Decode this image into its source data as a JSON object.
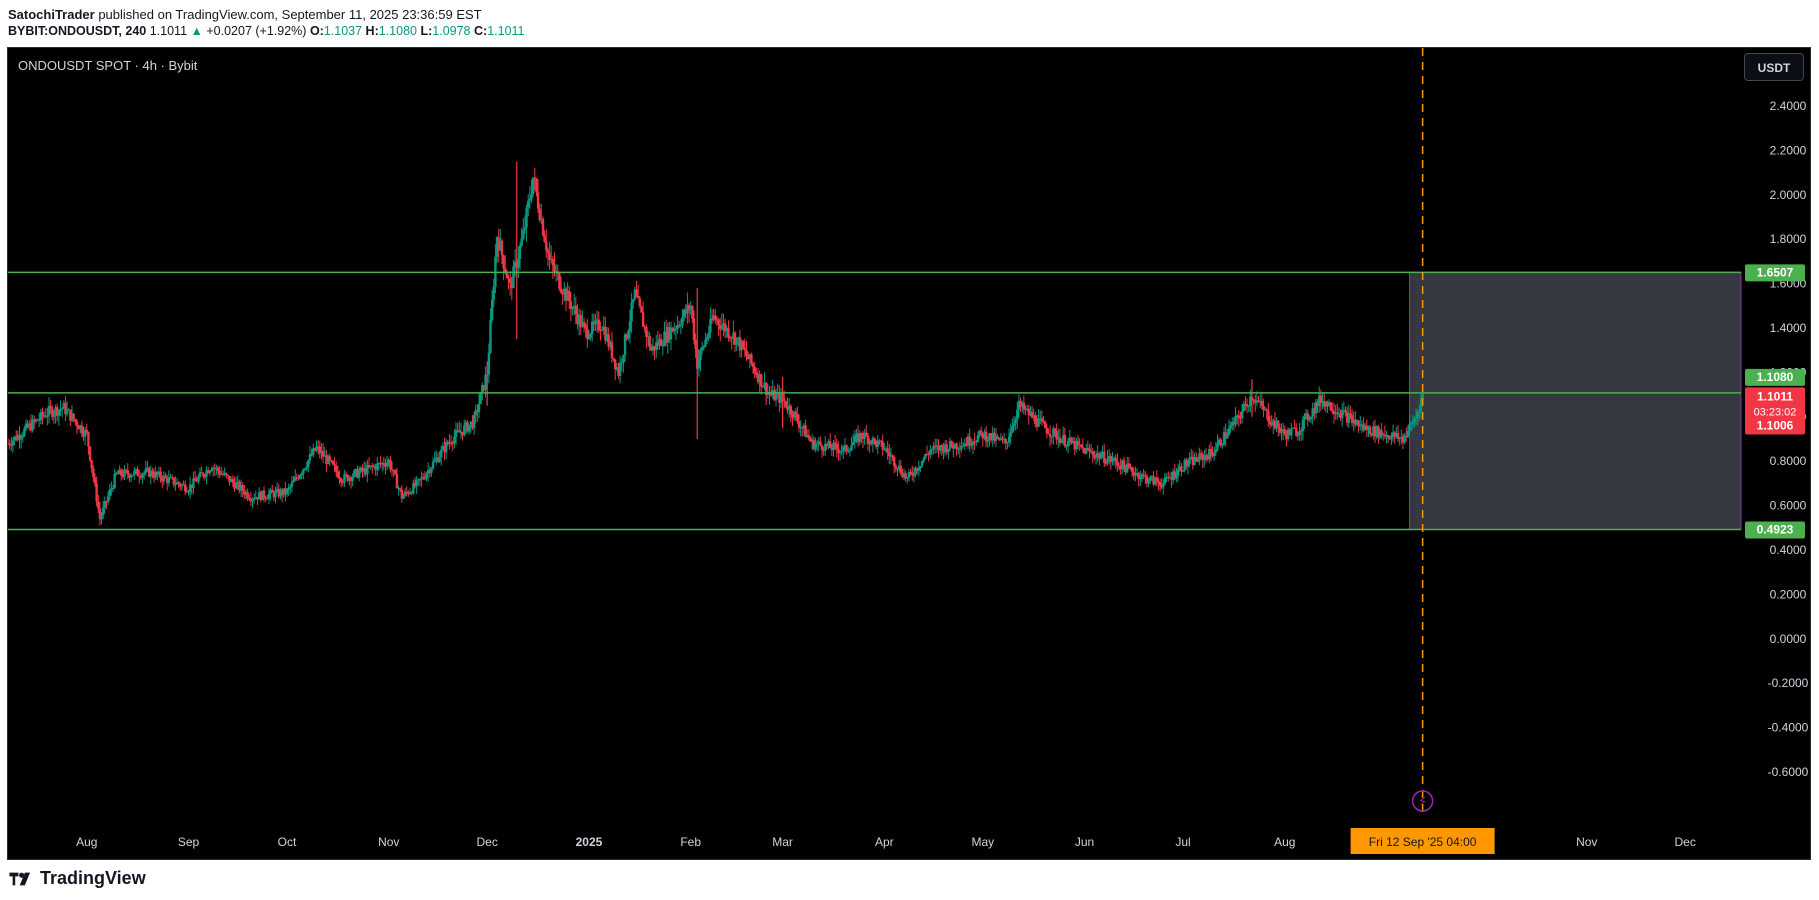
{
  "header": {
    "author": "SatochiTrader",
    "published_text": "published on TradingView.com, September 11, 2025 23:36:59 EST",
    "symbol_line": "BYBIT:ONDOUSDT, 240",
    "last": "1.1011",
    "change": "+0.0207 (+1.92%)",
    "o_label": "O:",
    "o_value": "1.1037",
    "h_label": "H:",
    "h_value": "1.1080",
    "l_label": "L:",
    "l_value": "1.0978",
    "c_label": "C:",
    "c_value": "1.1011"
  },
  "chart_title": "ONDOUSDT SPOT · 4h · Bybit",
  "currency_button": "USDT",
  "footer": {
    "brand": "TradingView"
  },
  "colors": {
    "background": "#000000",
    "up_candle": "#089981",
    "down_candle": "#f23645",
    "level_line": "#4caf50",
    "box_fill": "#434651",
    "box_border": "#9c27b0",
    "crosshair": "#ff9800"
  },
  "chart_data": {
    "type": "candlestick",
    "title": "ONDOUSDT SPOT · 4h · Bybit",
    "ylim": [
      -0.7,
      2.5
    ],
    "y_ticks": [
      "2.4000",
      "2.2000",
      "2.0000",
      "1.8000",
      "1.6000",
      "1.4000",
      "1.2000",
      "1.0000",
      "0.8000",
      "0.6000",
      "0.4000",
      "0.2000",
      "0.0000",
      "-0.2000",
      "-0.4000",
      "-0.6000"
    ],
    "y_tick_values": [
      2.4,
      2.2,
      2.0,
      1.8,
      1.6,
      1.4,
      1.2,
      1.0,
      0.8,
      0.6,
      0.4,
      0.2,
      0.0,
      -0.2,
      -0.4,
      -0.6
    ],
    "x_ticks": [
      "Aug",
      "Sep",
      "Oct",
      "Nov",
      "Dec",
      "2025",
      "Feb",
      "Mar",
      "Apr",
      "May",
      "Jun",
      "Jul",
      "Aug",
      "Sep",
      "Oct",
      "Nov",
      "Dec"
    ],
    "x_tick_dates": [
      "2024-08-01",
      "2024-09-01",
      "2024-10-01",
      "2024-11-01",
      "2024-12-01",
      "2025-01-01",
      "2025-02-01",
      "2025-03-01",
      "2025-04-01",
      "2025-05-01",
      "2025-06-01",
      "2025-07-01",
      "2025-08-01",
      "2025-09-01",
      "2025-10-01",
      "2025-11-01",
      "2025-12-01"
    ],
    "x_hidden_ticks": [
      13,
      14
    ],
    "x_range": [
      "2024-07-08",
      "2025-12-18"
    ],
    "price_path": [
      [
        "2024-07-08",
        0.88
      ],
      [
        "2024-07-20",
        1.02
      ],
      [
        "2024-07-25",
        1.04
      ],
      [
        "2024-08-01",
        0.92
      ],
      [
        "2024-08-05",
        0.54
      ],
      [
        "2024-08-10",
        0.74
      ],
      [
        "2024-08-20",
        0.75
      ],
      [
        "2024-09-01",
        0.68
      ],
      [
        "2024-09-08",
        0.78
      ],
      [
        "2024-09-20",
        0.64
      ],
      [
        "2024-10-01",
        0.66
      ],
      [
        "2024-10-10",
        0.86
      ],
      [
        "2024-10-18",
        0.72
      ],
      [
        "2024-11-01",
        0.8
      ],
      [
        "2024-11-05",
        0.64
      ],
      [
        "2024-11-10",
        0.7
      ],
      [
        "2024-11-20",
        0.9
      ],
      [
        "2024-11-27",
        0.98
      ],
      [
        "2024-12-01",
        1.2
      ],
      [
        "2024-12-04",
        1.82
      ],
      [
        "2024-12-08",
        1.58
      ],
      [
        "2024-12-12",
        1.82
      ],
      [
        "2024-12-15",
        2.08
      ],
      [
        "2024-12-20",
        1.7
      ],
      [
        "2024-12-25",
        1.55
      ],
      [
        "2024-12-31",
        1.38
      ],
      [
        "2025-01-05",
        1.42
      ],
      [
        "2025-01-10",
        1.2
      ],
      [
        "2025-01-15",
        1.55
      ],
      [
        "2025-01-20",
        1.3
      ],
      [
        "2025-01-28",
        1.42
      ],
      [
        "2025-02-01",
        1.5
      ],
      [
        "2025-02-03",
        1.24
      ],
      [
        "2025-02-08",
        1.45
      ],
      [
        "2025-02-15",
        1.35
      ],
      [
        "2025-02-25",
        1.1
      ],
      [
        "2025-03-01",
        1.08
      ],
      [
        "2025-03-04",
        1.02
      ],
      [
        "2025-03-10",
        0.88
      ],
      [
        "2025-03-20",
        0.85
      ],
      [
        "2025-03-25",
        0.92
      ],
      [
        "2025-04-01",
        0.86
      ],
      [
        "2025-04-08",
        0.72
      ],
      [
        "2025-04-15",
        0.85
      ],
      [
        "2025-04-25",
        0.88
      ],
      [
        "2025-05-01",
        0.92
      ],
      [
        "2025-05-08",
        0.88
      ],
      [
        "2025-05-12",
        1.05
      ],
      [
        "2025-05-20",
        0.95
      ],
      [
        "2025-05-25",
        0.9
      ],
      [
        "2025-06-01",
        0.85
      ],
      [
        "2025-06-10",
        0.8
      ],
      [
        "2025-06-20",
        0.72
      ],
      [
        "2025-06-25",
        0.7
      ],
      [
        "2025-07-01",
        0.78
      ],
      [
        "2025-07-10",
        0.84
      ],
      [
        "2025-07-18",
        1.0
      ],
      [
        "2025-07-22",
        1.1
      ],
      [
        "2025-07-28",
        0.98
      ],
      [
        "2025-08-01",
        0.92
      ],
      [
        "2025-08-05",
        0.94
      ],
      [
        "2025-08-12",
        1.08
      ],
      [
        "2025-08-18",
        1.02
      ],
      [
        "2025-08-25",
        0.95
      ],
      [
        "2025-09-01",
        0.92
      ],
      [
        "2025-09-06",
        0.9
      ],
      [
        "2025-09-10",
        1.0
      ],
      [
        "2025-09-12",
        1.1
      ]
    ],
    "spikes": [
      {
        "date": "2024-12-01",
        "high": 1.25,
        "low": 1.05
      },
      {
        "date": "2024-12-10",
        "high": 2.15,
        "low": 1.35
      },
      {
        "date": "2025-02-03",
        "high": 1.58,
        "low": 0.9
      },
      {
        "date": "2025-03-01",
        "high": 1.18,
        "low": 0.95
      },
      {
        "date": "2025-07-22",
        "high": 1.17,
        "low": 1.0
      }
    ],
    "horizontal_levels": [
      1.6507,
      1.108,
      0.4923
    ],
    "price_labels": [
      {
        "value": 1.6507,
        "text": "1.6507",
        "color": "#4caf50"
      },
      {
        "value": 1.108,
        "text": "1.1080",
        "color": "#4caf50"
      },
      {
        "value": 1.1011,
        "text": "1.1011",
        "color": "#f23645",
        "countdown": "03:23:02"
      },
      {
        "value": 1.1006,
        "text": "1.1006",
        "color": "#f23645"
      },
      {
        "value": 0.4923,
        "text": "0.4923",
        "color": "#4caf50"
      }
    ],
    "box": {
      "start": "2025-09-08",
      "end": "2025-12-18",
      "top": 1.6507,
      "bottom": 0.4923
    },
    "crosshair": {
      "date": "2025-09-12",
      "label": "Fri 12 Sep '25   04:00"
    }
  }
}
